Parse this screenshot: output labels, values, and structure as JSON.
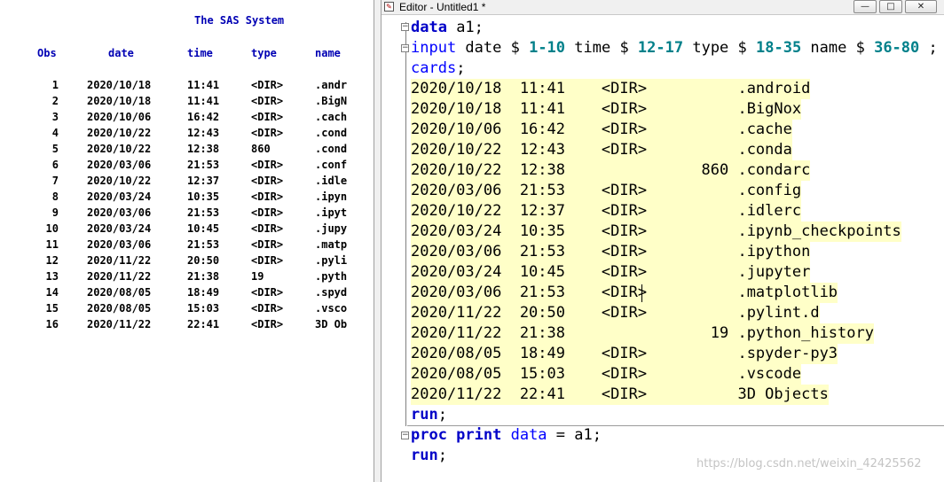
{
  "output": {
    "title": "The SAS System",
    "headers": {
      "obs": "Obs",
      "date": "date",
      "time": "time",
      "type": "type",
      "name": "name"
    },
    "rows": [
      {
        "obs": "1",
        "date": "2020/10/18",
        "time": "11:41",
        "type": "<DIR>",
        "name": ".andr"
      },
      {
        "obs": "2",
        "date": "2020/10/18",
        "time": "11:41",
        "type": "<DIR>",
        "name": ".BigN"
      },
      {
        "obs": "3",
        "date": "2020/10/06",
        "time": "16:42",
        "type": "<DIR>",
        "name": ".cach"
      },
      {
        "obs": "4",
        "date": "2020/10/22",
        "time": "12:43",
        "type": "<DIR>",
        "name": ".cond"
      },
      {
        "obs": "5",
        "date": "2020/10/22",
        "time": "12:38",
        "type": "860",
        "name": ".cond"
      },
      {
        "obs": "6",
        "date": "2020/03/06",
        "time": "21:53",
        "type": "<DIR>",
        "name": ".conf"
      },
      {
        "obs": "7",
        "date": "2020/10/22",
        "time": "12:37",
        "type": "<DIR>",
        "name": ".idle"
      },
      {
        "obs": "8",
        "date": "2020/03/24",
        "time": "10:35",
        "type": "<DIR>",
        "name": ".ipyn"
      },
      {
        "obs": "9",
        "date": "2020/03/06",
        "time": "21:53",
        "type": "<DIR>",
        "name": ".ipyt"
      },
      {
        "obs": "10",
        "date": "2020/03/24",
        "time": "10:45",
        "type": "<DIR>",
        "name": ".jupy"
      },
      {
        "obs": "11",
        "date": "2020/03/06",
        "time": "21:53",
        "type": "<DIR>",
        "name": ".matp"
      },
      {
        "obs": "12",
        "date": "2020/11/22",
        "time": "20:50",
        "type": "<DIR>",
        "name": ".pyli"
      },
      {
        "obs": "13",
        "date": "2020/11/22",
        "time": "21:38",
        "type": "19",
        "name": ".pyth"
      },
      {
        "obs": "14",
        "date": "2020/08/05",
        "time": "18:49",
        "type": "<DIR>",
        "name": ".spyd"
      },
      {
        "obs": "15",
        "date": "2020/08/05",
        "time": "15:03",
        "type": "<DIR>",
        "name": ".vsco"
      },
      {
        "obs": "16",
        "date": "2020/11/22",
        "time": "22:41",
        "type": "<DIR>",
        "name": "3D Ob"
      }
    ]
  },
  "editor": {
    "title": "Editor - Untitled1 *",
    "window_buttons": {
      "minimize": "—",
      "maximize": "□",
      "close": "✕"
    },
    "fold_symbol": "−",
    "code": {
      "l1_kw": "data",
      "l1_rest": " a1;",
      "l2_kw": "input",
      "l2_a": " date $ ",
      "l2_b": "1-10",
      "l2_c": " time $ ",
      "l2_d": "12-17",
      "l2_e": " type $ ",
      "l2_f": "18-35",
      "l2_g": " name $ ",
      "l2_h": "36-80",
      "l2_i": " ;",
      "l3_kw": "cards",
      "l3_rest": ";",
      "run1": "run",
      "run1_rest": ";",
      "proc_kw": "proc print",
      "proc_data": " data",
      "proc_rest": " = a1;",
      "run2": "run",
      "run2_rest": ";"
    },
    "cards_lines": [
      "2020/10/18  11:41    <DIR>          .android",
      "2020/10/18  11:41    <DIR>          .BigNox",
      "2020/10/06  16:42    <DIR>          .cache",
      "2020/10/22  12:43    <DIR>          .conda",
      "2020/10/22  12:38               860 .condarc",
      "2020/03/06  21:53    <DIR>          .config",
      "2020/10/22  12:37    <DIR>          .idlerc",
      "2020/03/24  10:35    <DIR>          .ipynb_checkpoints",
      "2020/03/06  21:53    <DIR>          .ipython",
      "2020/03/24  10:45    <DIR>          .jupyter",
      "2020/03/06  21:53    <DIR>          .matplotlib",
      "2020/11/22  20:50    <DIR>          .pylint.d",
      "2020/11/22  21:38                19 .python_history",
      "2020/08/05  18:49    <DIR>          .spyder-py3",
      "2020/08/05  15:03    <DIR>          .vscode",
      "2020/11/22  22:41    <DIR>          3D Objects"
    ]
  },
  "watermark": "https://blog.csdn.net/weixin_42425562"
}
